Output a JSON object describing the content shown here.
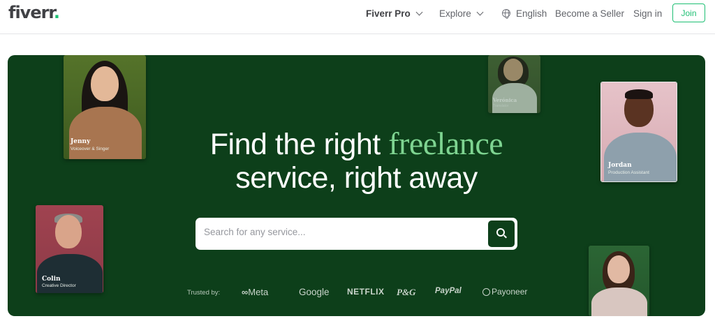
{
  "header": {
    "logo": "fiverr",
    "logo_dot": ".",
    "nav": {
      "fiverr_pro": "Fiverr Pro",
      "explore": "Explore",
      "english": "English",
      "become_seller": "Become a Seller",
      "sign_in": "Sign in",
      "join": "Join"
    }
  },
  "hero": {
    "title_part1": "Find the right ",
    "title_accent": "freelance",
    "title_line2": "service, right away",
    "search": {
      "placeholder": "Search for any service..."
    },
    "trusted_by": {
      "label": "Trusted by:",
      "brands": [
        "Meta",
        "Google",
        "NETFLIX",
        "P&G",
        "PayPal",
        "Payoneer"
      ]
    },
    "cards": [
      {
        "name": "Jenny",
        "role": "Voiceover & Singer"
      },
      {
        "name": "Verónica",
        "role": "Translator"
      },
      {
        "name": "Jordan",
        "role": "Production Assistant"
      },
      {
        "name": "Colin",
        "role": "Creative Director"
      }
    ]
  },
  "colors": {
    "brand_green": "#1dbf73",
    "hero_bg": "#0d3f1a",
    "accent_green": "#7ed491"
  },
  "icons": [
    "chevron-down-icon",
    "globe-icon",
    "search-icon",
    "meta-logo-icon",
    "payoneer-logo-icon"
  ]
}
